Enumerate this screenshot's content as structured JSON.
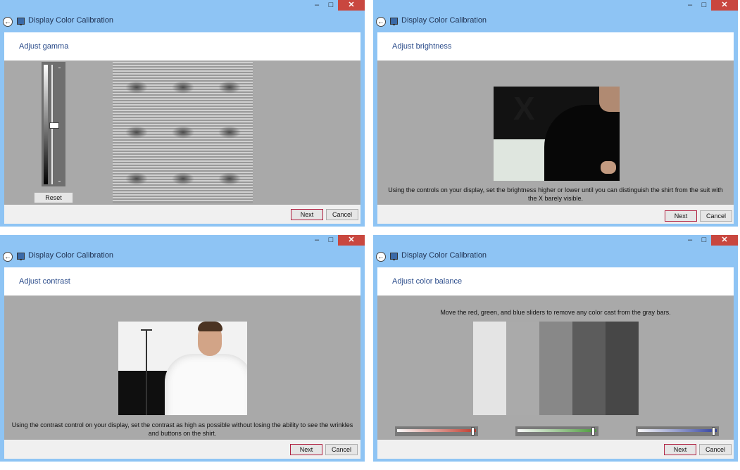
{
  "app_title": "Display Color Calibration",
  "window_controls": {
    "minimize": "–",
    "maximize": "□",
    "close": "✕"
  },
  "buttons": {
    "next": "Next",
    "cancel": "Cancel",
    "reset": "Reset"
  },
  "panels": {
    "gamma": {
      "heading": "Adjust gamma"
    },
    "brightness": {
      "heading": "Adjust brightness",
      "description": "Using the controls on your display, set the brightness higher or lower until you can distinguish the shirt from the suit with the X barely visible."
    },
    "contrast": {
      "heading": "Adjust contrast",
      "description": "Using the contrast control on your display, set the contrast as high as possible without losing the ability to see the wrinkles and buttons on the shirt."
    },
    "color_balance": {
      "heading": "Adjust color balance",
      "description": "Move the red, green, and blue sliders to remove any color cast from the gray bars.",
      "gray_bars": [
        "#e4e4e4",
        "#aaaaaa",
        "#888888",
        "#5c5c5c",
        "#474747"
      ],
      "sliders": [
        {
          "channel": "red",
          "color": "#c0392b",
          "level": 0.95
        },
        {
          "channel": "green",
          "color": "#4a9a3a",
          "level": 0.95
        },
        {
          "channel": "blue",
          "color": "#3040a0",
          "level": 0.95
        }
      ]
    }
  },
  "gamma_slider_level": 0.5
}
